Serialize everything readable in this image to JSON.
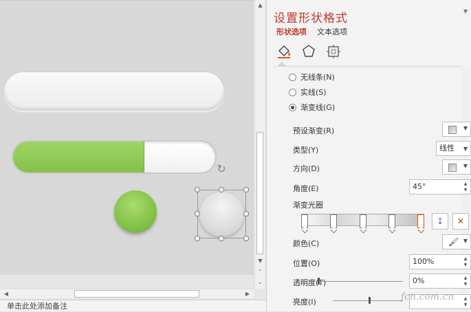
{
  "notes": {
    "placeholder": "单击此处添加备注"
  },
  "pane": {
    "title": "设置形状格式",
    "tabs": [
      {
        "label": "形状选项",
        "active": true
      },
      {
        "label": "文本选项",
        "active": false
      }
    ],
    "icons": [
      "fill-line-icon",
      "effects-pentagon-icon",
      "size-properties-icon"
    ],
    "line_options": [
      {
        "label": "无线条(N)",
        "selected": false
      },
      {
        "label": "实线(S)",
        "selected": false
      },
      {
        "label": "渐变线(G)",
        "selected": true
      }
    ],
    "properties": {
      "preset_gradient_label": "预设渐变(R)",
      "type_label": "类型(Y)",
      "type_value": "线性",
      "direction_label": "方向(D)",
      "angle_label": "角度(E)",
      "angle_value": "45°",
      "gradient_stops_label": "渐变光圈",
      "color_label": "颜色(C)",
      "position_label": "位置(O)",
      "position_value": "100%",
      "transparency_label": "透明度(T)",
      "transparency_value": "0%",
      "brightness_label": "亮度(I)"
    },
    "gradient_stop_count": 5,
    "selected_stop_index": 4
  },
  "slide": {
    "progress_fill_fraction": 0.65
  },
  "colors": {
    "accent": "#c0392b",
    "green": "#8cc94f"
  },
  "watermark": "fcn.com.cn"
}
